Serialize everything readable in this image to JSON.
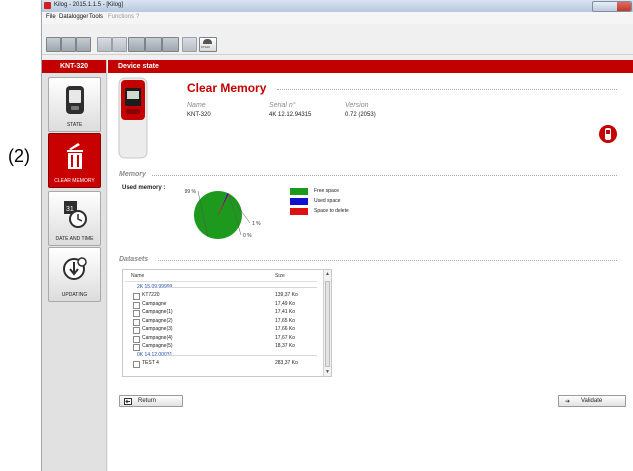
{
  "window": {
    "title": "Kilog - 2015.1.1.5 - [Kilog]"
  },
  "menu": [
    {
      "label": "File",
      "enabled": true
    },
    {
      "label": "Datalogger",
      "enabled": true
    },
    {
      "label": "Tools",
      "enabled": true
    },
    {
      "label": "Functions",
      "enabled": false
    },
    {
      "label": "?",
      "enabled": false
    }
  ],
  "toolbar": {
    "kistock_label": "KT100"
  },
  "annotation": "(2)",
  "nav": {
    "device": "KNT-320",
    "items": [
      {
        "label": "STATE",
        "icon": "device-state-icon",
        "active": false
      },
      {
        "label": "CLEAR MEMORY",
        "icon": "trash-icon",
        "active": true
      },
      {
        "label": "DATE AND TIME",
        "icon": "calendar-clock-icon",
        "active": false
      },
      {
        "label": "UPDATING",
        "icon": "update-icon",
        "active": false
      }
    ]
  },
  "content": {
    "header": "Device state",
    "title": "Clear Memory",
    "device": {
      "name_label": "Name",
      "serial_label": "Serial n°",
      "version_label": "Version",
      "name": "KNT-320",
      "serial": "4K 12.12.94315",
      "version": "0.72 (2053)"
    },
    "memory_section": "Memory",
    "used_memory_label": "Used memory :",
    "datasets_section": "Datasets",
    "return_label": "Return",
    "validate_label": "Validate"
  },
  "chart_data": {
    "type": "pie",
    "slices": [
      {
        "name": "Free space",
        "value": 99,
        "label": "99 %",
        "color": "#1d9a1d"
      },
      {
        "name": "Used space",
        "value": 1,
        "label": "1 %",
        "color": "#1111cc"
      },
      {
        "name": "Space to delete",
        "value": 0,
        "label": "0 %",
        "color": "#dd1111"
      }
    ],
    "legend_position": "right"
  },
  "datasets": {
    "columns": {
      "name": "Name",
      "size": "Size"
    },
    "groups": [
      {
        "id": "2K 15.09.99999",
        "rows": [
          {
            "name": "KT7220",
            "size": "139,37 Ko"
          },
          {
            "name": "Campagne",
            "size": "17,49 Ko"
          },
          {
            "name": "Campagne(1)",
            "size": "17,41 Ko"
          },
          {
            "name": "Campagne(2)",
            "size": "17,65 Ko"
          },
          {
            "name": "Campagne(3)",
            "size": "17,66 Ko"
          },
          {
            "name": "Campagne(4)",
            "size": "17,67 Ko"
          },
          {
            "name": "Campagne(5)",
            "size": "18,37 Ko"
          }
        ]
      },
      {
        "id": "0K 14.12.00031",
        "rows": [
          {
            "name": "TEST 4",
            "size": "283,37 Ko"
          }
        ]
      }
    ]
  }
}
